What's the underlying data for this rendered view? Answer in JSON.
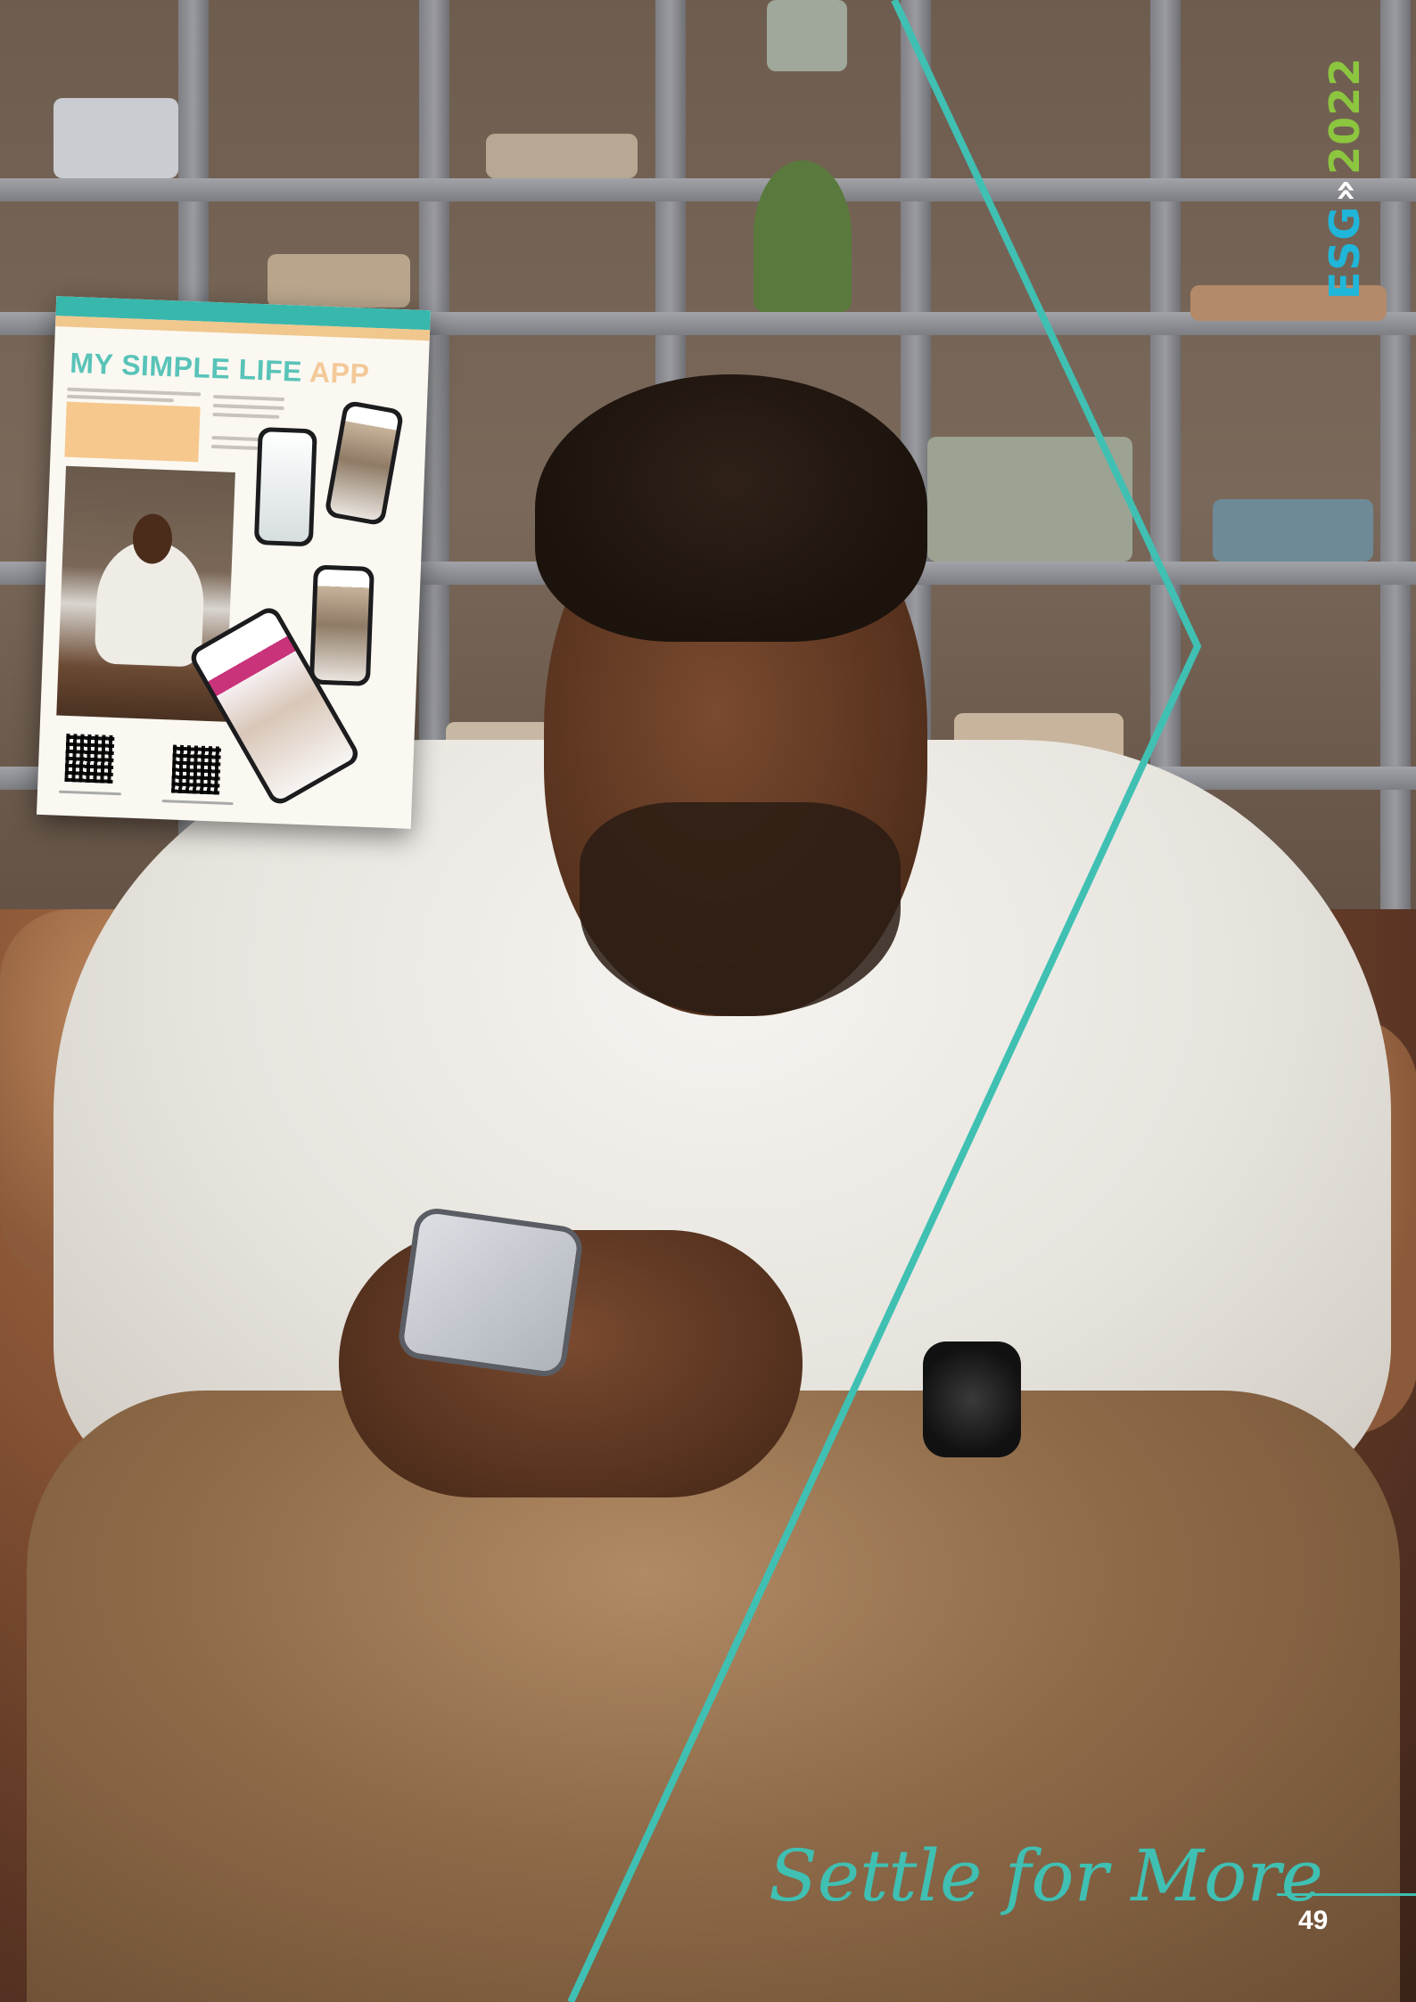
{
  "brand": {
    "esg": "ESG",
    "separator": "»",
    "year": "2022",
    "colors": {
      "esg": "#1fb6d9",
      "year": "#8cc63f",
      "accent_teal": "#3fc0b3"
    }
  },
  "report_thumbnail": {
    "title_main": "MY SIMPLE LIFE",
    "title_suffix": "APP"
  },
  "footer": {
    "tagline": "Settle for More",
    "page_number": "49"
  },
  "icons": [
    "qr-code-icon",
    "smartphone-icon"
  ]
}
